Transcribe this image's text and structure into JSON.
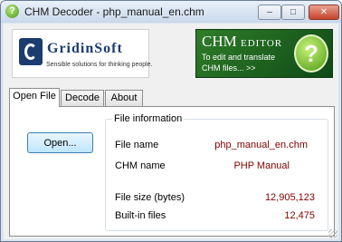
{
  "window": {
    "title": "CHM Decoder - php_manual_en.chm",
    "icon": "question-icon",
    "controls": {
      "minimize": "–",
      "maximize": "□",
      "close": "✕"
    }
  },
  "banners": {
    "gridinsoft": {
      "name": "GridinSoft",
      "tagline": "Sensible solutions for thinking people."
    },
    "chm_editor": {
      "title_big": "CHM",
      "title_small": "EDITOR",
      "line1": "To edit and translate",
      "line2": "CHM files... >>",
      "badge": "?"
    }
  },
  "tabs": [
    {
      "label": "Open File",
      "active": true
    },
    {
      "label": "Decode",
      "active": false
    },
    {
      "label": "About",
      "active": false
    }
  ],
  "open_file": {
    "open_button": "Open...",
    "file_info": {
      "legend": "File information",
      "file_name_label": "File name",
      "file_name_value": "php_manual_en.chm",
      "chm_name_label": "CHM name",
      "chm_name_value": "PHP Manual",
      "file_size_label": "File size (bytes)",
      "file_size_value": "12,905,123",
      "builtin_files_label": "Built-in files",
      "builtin_files_value": "12,475"
    }
  },
  "colors": {
    "value_text": "#800000",
    "banner_green": "#2f7d28",
    "gridinsoft_blue": "#1b3c70"
  }
}
